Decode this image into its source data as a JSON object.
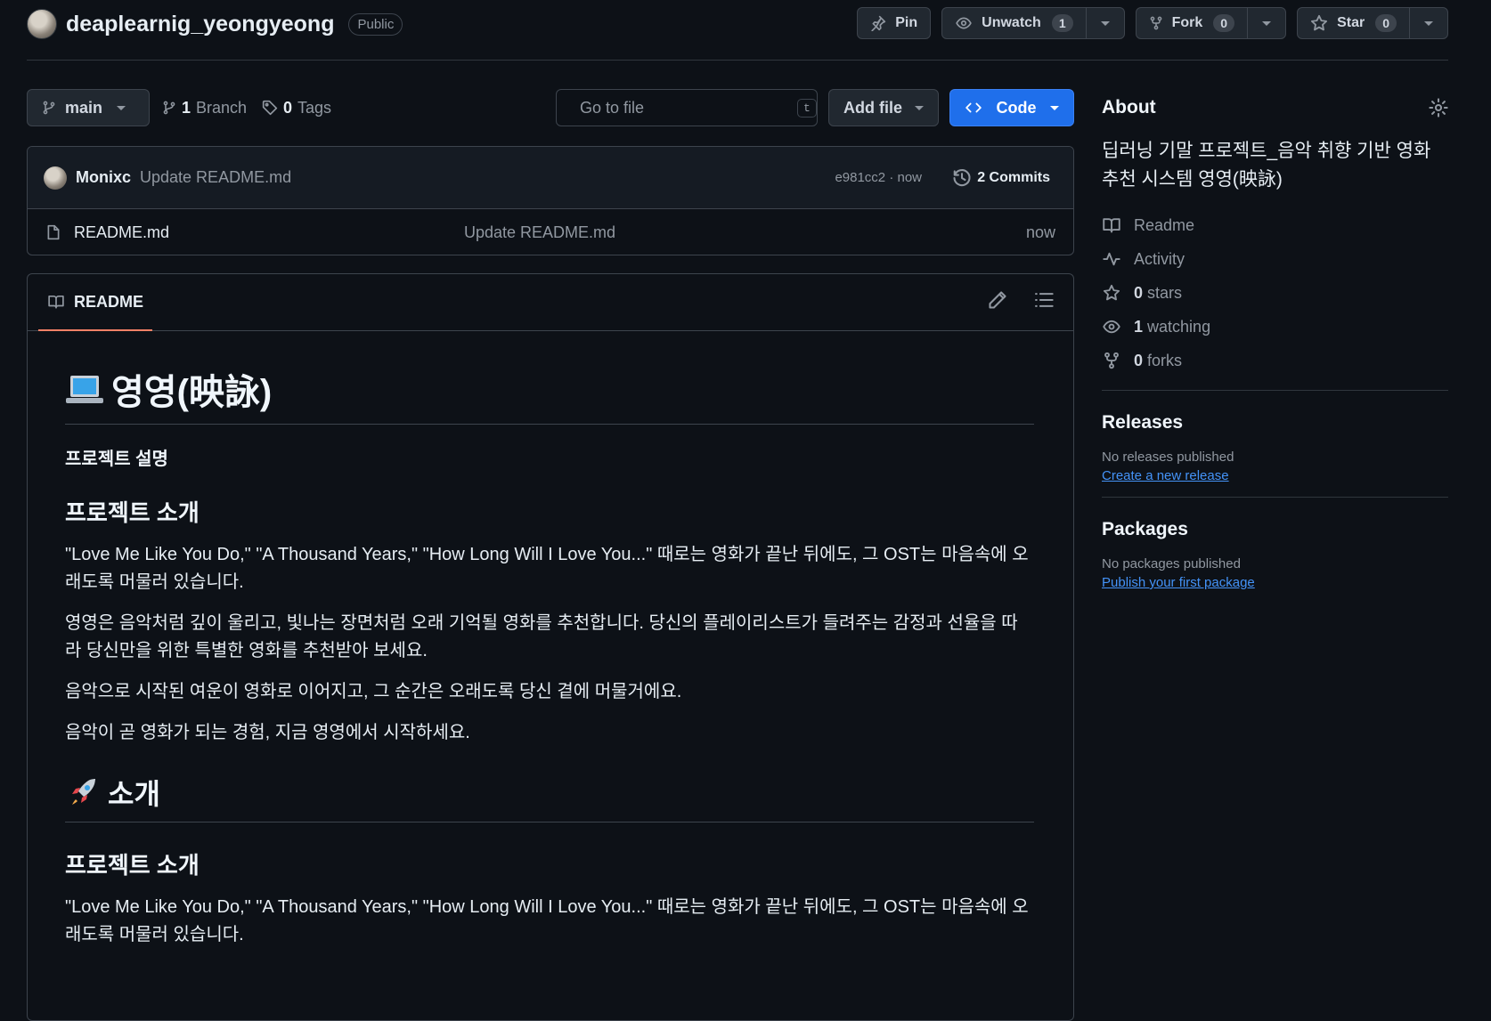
{
  "repo": {
    "name": "deaplearnig_yeongyeong",
    "visibility": "Public"
  },
  "header_actions": {
    "pin": "Pin",
    "unwatch": "Unwatch",
    "watch_count": "1",
    "fork": "Fork",
    "fork_count": "0",
    "star": "Star",
    "star_count": "0"
  },
  "branch_bar": {
    "branch": "main",
    "branch_count": "1",
    "branch_label": "Branch",
    "tag_count": "0",
    "tag_label": "Tags",
    "go_to_file_placeholder": "Go to file",
    "go_to_file_key": "t",
    "add_file": "Add file",
    "code": "Code"
  },
  "latest_commit": {
    "author": "Monixc",
    "message": "Update README.md",
    "meta": "e981cc2 · now",
    "commits_label": "2 Commits"
  },
  "files": [
    {
      "name": "README.md",
      "message": "Update README.md",
      "time": "now"
    }
  ],
  "readme": {
    "tab": "README",
    "h1_title": "영영(映詠)",
    "h3_desc": "프로젝트 설명",
    "h2_intro": "프로젝트 소개",
    "p1": "\"Love Me Like You Do,\" \"A Thousand Years,\" \"How Long Will I Love You...\" 때로는 영화가 끝난 뒤에도, 그 OST는 마음속에 오래도록 머물러 있습니다.",
    "p2": "영영은 음악처럼 깊이 울리고, 빛나는 장면처럼 오래 기억될 영화를 추천합니다. 당신의 플레이리스트가 들려주는 감정과 선율을 따라 당신만을 위한 특별한 영화를 추천받아 보세요.",
    "p3": "음악으로 시작된 여운이 영화로 이어지고, 그 순간은 오래도록 당신 곁에 머물거에요.",
    "p4": "음악이 곧 영화가 되는 경험, 지금 영영에서 시작하세요.",
    "h1_second": "소개",
    "h2_intro_2": "프로젝트 소개",
    "p5": "\"Love Me Like You Do,\" \"A Thousand Years,\" \"How Long Will I Love You...\" 때로는 영화가 끝난 뒤에도, 그 OST는 마음속에 오래도록 머물러 있습니다."
  },
  "about": {
    "title": "About",
    "description": "딥러닝 기말 프로젝트_음악 취향 기반 영화 추천 시스템 영영(映詠)",
    "items": [
      {
        "icon": "book-icon",
        "count": "",
        "label": "Readme"
      },
      {
        "icon": "pulse-icon",
        "count": "",
        "label": "Activity"
      },
      {
        "icon": "star-icon",
        "count": "0",
        "label": "stars"
      },
      {
        "icon": "eye-icon",
        "count": "1",
        "label": "watching"
      },
      {
        "icon": "fork-icon",
        "count": "0",
        "label": "forks"
      }
    ]
  },
  "releases": {
    "title": "Releases",
    "empty": "No releases published",
    "link": "Create a new release"
  },
  "packages": {
    "title": "Packages",
    "empty": "No packages published",
    "link": "Publish your first package"
  },
  "colors": {
    "background": "#0d1117",
    "accent": "#1f6feb",
    "link": "#4493f8",
    "tab_underline": "#f78166"
  }
}
